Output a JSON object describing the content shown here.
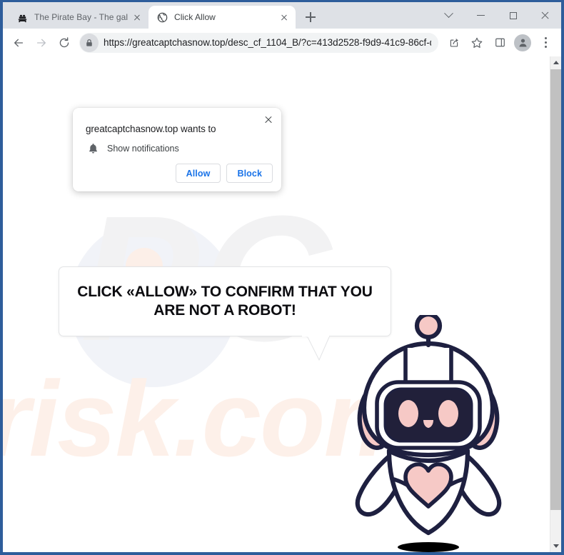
{
  "window": {
    "controls": [
      {
        "name": "tab-search",
        "icon": "chevron-down-icon"
      },
      {
        "name": "minimize",
        "icon": "minimize-icon"
      },
      {
        "name": "maximize",
        "icon": "maximize-icon"
      },
      {
        "name": "close",
        "icon": "close-icon"
      }
    ]
  },
  "tabs": [
    {
      "title": "The Pirate Bay - The galaxy's mos",
      "favicon": "ship-icon",
      "active": false
    },
    {
      "title": "Click Allow",
      "favicon": "globe-icon",
      "active": true
    }
  ],
  "new_tab_label": "+",
  "toolbar": {
    "back_icon": "back-arrow-icon",
    "forward_icon": "forward-arrow-icon",
    "reload_icon": "reload-icon",
    "lock_icon": "lock-icon",
    "url": "https://greatcaptchasnow.top/desc_cf_1104_B/?c=413d2528-f9d9-41c9-86cf-d1287d9...",
    "share_icon": "share-icon",
    "bookmark_icon": "star-icon",
    "side_panel_icon": "side-panel-icon",
    "profile_icon": "profile-avatar-icon",
    "menu_icon": "kebab-menu-icon"
  },
  "notification_popup": {
    "title": "greatcaptchasnow.top wants to",
    "permission_label": "Show notifications",
    "permission_icon": "bell-icon",
    "allow_label": "Allow",
    "block_label": "Block",
    "close_icon": "close-icon"
  },
  "page": {
    "speech_text": "CLICK «ALLOW» TO CONFIRM THAT YOU\nARE NOT A ROBOT!",
    "watermark_primary": "PC",
    "watermark_secondary": "risk.com",
    "mascot": "robot-mascot"
  },
  "colors": {
    "window_frame": "#2e5d9b",
    "tab_strip": "#dee1e6",
    "omnibox_bg": "#f1f3f4",
    "link_blue": "#1a73e8",
    "robot_outline": "#1e2040",
    "robot_pink": "#f6c9c6",
    "watermark_gray": "#f2f2f3",
    "watermark_peach": "#fdf0e9"
  },
  "scrollbar": {
    "up_icon": "scroll-up-arrow-icon",
    "down_icon": "scroll-down-arrow-icon"
  }
}
